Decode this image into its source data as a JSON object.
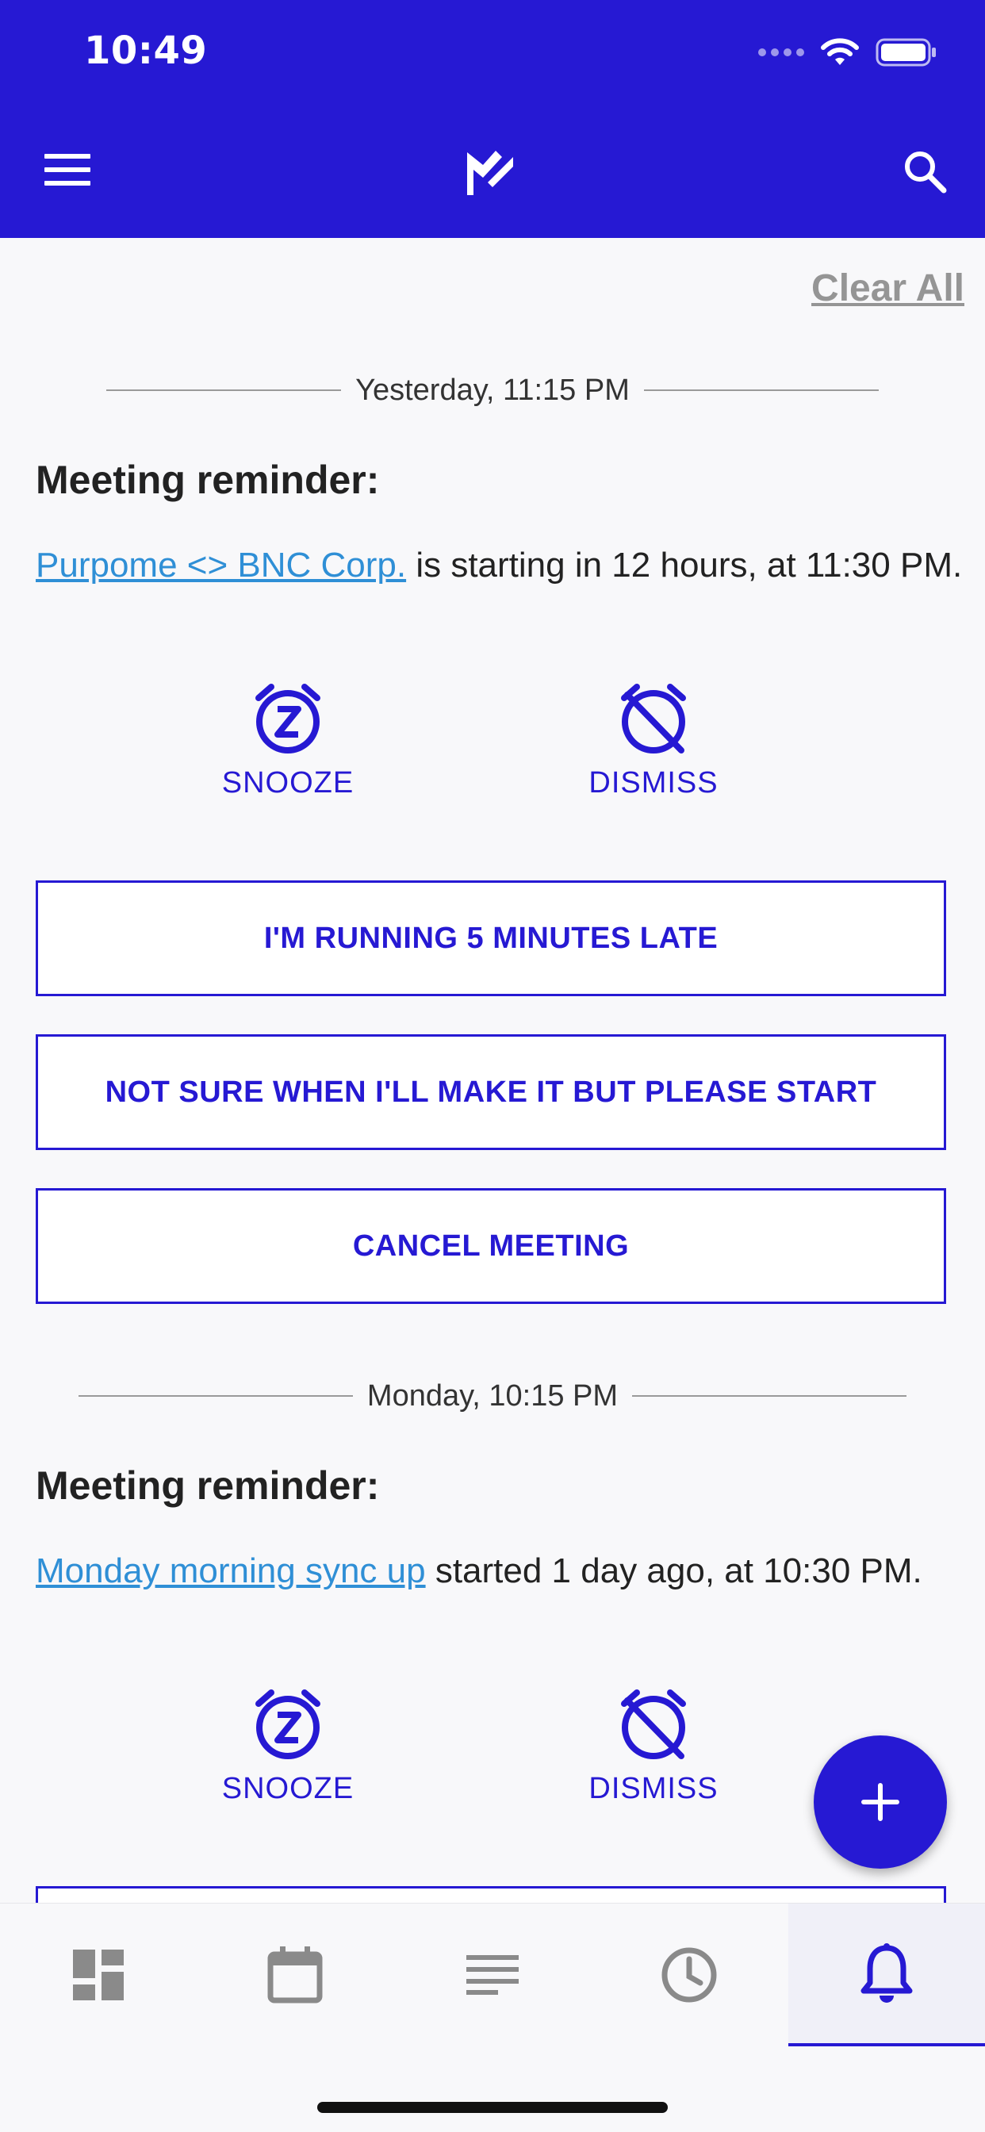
{
  "status_bar": {
    "time": "10:49"
  },
  "content": {
    "clear_all": "Clear All",
    "notifications": [
      {
        "timestamp": "Yesterday, 11:15 PM",
        "heading": "Meeting reminder:",
        "link": "Purpome <> BNC Corp.",
        "message": " is starting in 12 hours, at 11:30 PM.",
        "snooze_label": "SNOOZE",
        "dismiss_label": "DISMISS",
        "buttons": [
          "I'M RUNNING 5 MINUTES LATE",
          "NOT SURE WHEN I'LL MAKE IT BUT PLEASE START",
          "CANCEL MEETING"
        ]
      },
      {
        "timestamp": "Monday, 10:15 PM",
        "heading": "Meeting reminder:",
        "link": "Monday morning sync up",
        "message": " started 1 day ago, at 10:30 PM.",
        "snooze_label": "SNOOZE",
        "dismiss_label": "DISMISS"
      }
    ]
  },
  "tabs": [
    {
      "icon": "dashboard-icon",
      "active": false
    },
    {
      "icon": "calendar-icon",
      "active": false
    },
    {
      "icon": "notes-icon",
      "active": false
    },
    {
      "icon": "clock-icon",
      "active": false
    },
    {
      "icon": "bell-icon",
      "active": true
    }
  ],
  "colors": {
    "brand": "#2619d3",
    "link": "#2f8fd6",
    "icon_gray": "#8a8a8a"
  }
}
